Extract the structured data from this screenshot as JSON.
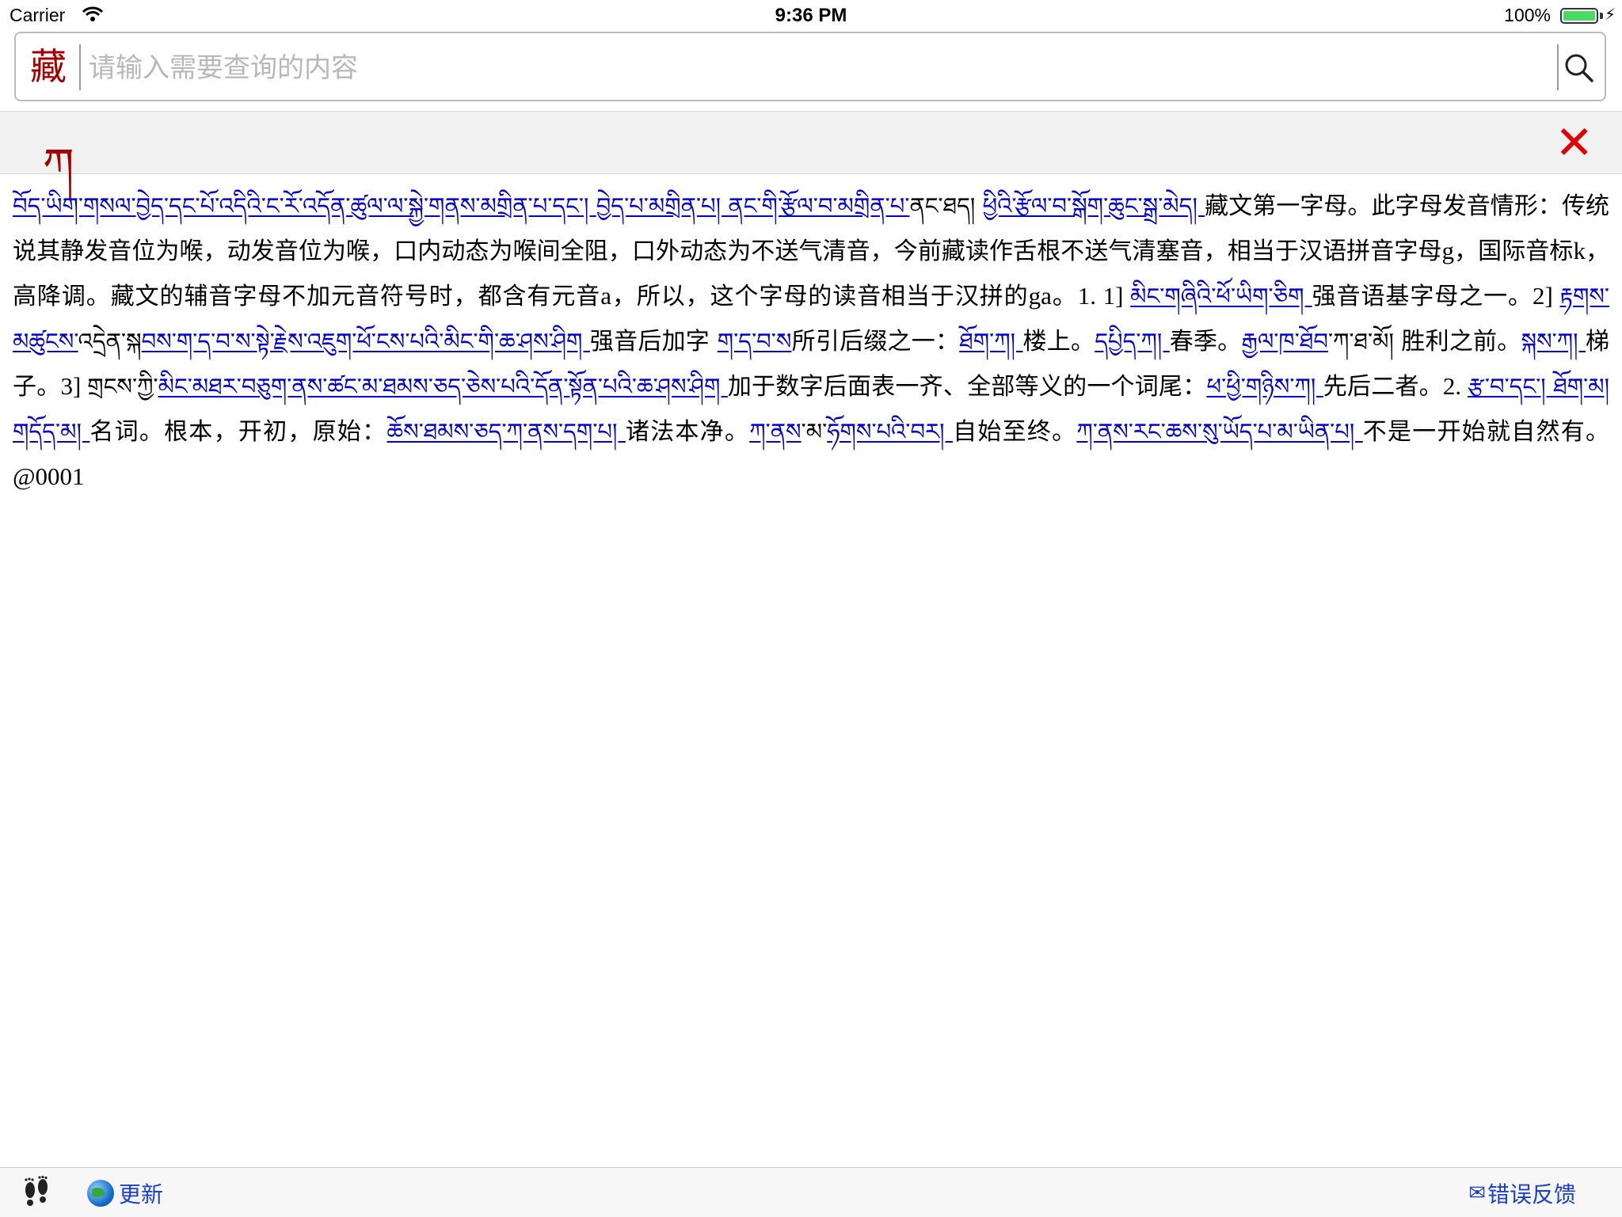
{
  "status_bar": {
    "carrier": "Carrier",
    "time": "9:36 PM",
    "battery": "100%",
    "battery_level": 1.0
  },
  "search": {
    "lang_toggle": "藏",
    "placeholder": "请输入需要查询的内容",
    "value": ""
  },
  "word": {
    "headword": "ཀ",
    "close_icon": "close-icon"
  },
  "definition": {
    "segments": [
      {
        "t": "བོད་ཡིག་གསལ་བྱེད་དང་པོ་འདིའི་ང་རོ་འདོན་ཚུལ་",
        "k": "tib"
      },
      {
        "t": "ལ་སྐྱེ་གནས་མགྲིན་པ་དང་། ",
        "k": "tib"
      },
      {
        "t": "བྱེད་པ་མགྲིན་པ། ",
        "k": "tib"
      },
      {
        "t": "ནང་གི་རྩོལ་བ་མགྲིན་པ་",
        "k": "tib"
      },
      {
        "t": "ནང་ཐད། ",
        "k": "tibplain"
      },
      {
        "t": "ཕྱིའི་རྩོལ་བ་སྒོག་ཆུང་སྒྲ་མེད། ",
        "k": "tib"
      },
      {
        "t": "藏文第一字母。此字母发音情形：传统说其静发音位为喉，动发音位为喉，口内动态为喉间全阻，口外动态为不送气清音，今前藏读作舌根不送气清塞音，相当于汉语拼音字母",
        "k": "zh"
      },
      {
        "t": "g",
        "k": "latin"
      },
      {
        "t": "，国际音标",
        "k": "zh"
      },
      {
        "t": "k",
        "k": "latin"
      },
      {
        "t": "，高降调。藏文的辅音字母不加元音符号时，都含有元音",
        "k": "zh"
      },
      {
        "t": "a",
        "k": "latin"
      },
      {
        "t": "，所以，这个字母的读音相当于汉拼的",
        "k": "zh"
      },
      {
        "t": "ga。1. 1] ",
        "k": "latin"
      },
      {
        "t": "མིང་གཞིའི་ཕོ་ཡིག་ཅིག ",
        "k": "tib"
      },
      {
        "t": "强音语基字母之一。",
        "k": "zh"
      },
      {
        "t": "2] ",
        "k": "latin"
      },
      {
        "t": "རྟགས་མཚུངས་",
        "k": "tib"
      },
      {
        "t": "འདྲེན་སྐ",
        "k": "tibplain"
      },
      {
        "t": "བས་ག་ད་བ་ས་སྟེ་རྗེས་འཇུག་ཕོ་ངས་པའི་མིང་གི་ཆ་ཤས་ཤིག ",
        "k": "tib"
      },
      {
        "t": "强音后加字 ",
        "k": "zh"
      },
      {
        "t": "ག་ད་བ་ས",
        "k": "tib"
      },
      {
        "t": "所引后缀之一：",
        "k": "zh"
      },
      {
        "t": "ཐོག་ཀ། ",
        "k": "tib"
      },
      {
        "t": "楼上。",
        "k": "zh"
      },
      {
        "t": "དཔྱིད་ཀ། ",
        "k": "tib"
      },
      {
        "t": "春季。",
        "k": "zh"
      },
      {
        "t": "རྒྱལ་ཁ་ཐོབ",
        "k": "tib"
      },
      {
        "t": "་ཀ་ཐ་མོ། ",
        "k": "tibplain"
      },
      {
        "t": "胜利之前。",
        "k": "zh"
      },
      {
        "t": "སྐས་ཀ། ",
        "k": "tib"
      },
      {
        "t": "梯子。",
        "k": "zh"
      },
      {
        "t": "3] ",
        "k": "latin"
      },
      {
        "t": "གྲངས་ཀྱི་",
        "k": "tibplain"
      },
      {
        "t": "མིང་མཐར་བཅུག་ནས་ཚང་མ་ཐམས་ཅད་ཅེས་པའི་དོན་སྟོན་པའི་ཆ་ཤས་ཤིག ",
        "k": "tib"
      },
      {
        "t": "加于数字后面表一齐、全部等义的一个词尾：",
        "k": "zh"
      },
      {
        "t": "ཕ་ཕྱི་གཉིས་ཀ། ",
        "k": "tib"
      },
      {
        "t": "先后二者。",
        "k": "zh"
      },
      {
        "t": "2. ",
        "k": "latin"
      },
      {
        "t": "རྩ་བ་དང་། ",
        "k": "tib"
      },
      {
        "t": "ཐོག་མ། ",
        "k": "tib"
      },
      {
        "t": "གདོད་མ། ",
        "k": "tib"
      },
      {
        "t": "名词。根本，开初，原始：",
        "k": "zh"
      },
      {
        "t": "ཆོས་ཐམས་ཅད་ཀ་ནས་དག་པ། ",
        "k": "tib"
      },
      {
        "t": "诸法本净。",
        "k": "zh"
      },
      {
        "t": "ཀ་ནས",
        "k": "tib"
      },
      {
        "t": "་མ་",
        "k": "tibplain"
      },
      {
        "t": "ཧོགས་པའི་བར། ",
        "k": "tib"
      },
      {
        "t": "自始至终。",
        "k": "zh"
      },
      {
        "t": "ཀ་ནས་རང་ཆས་སུ་ཡོད་པ་མ་ཡིན་པ། ",
        "k": "tib"
      },
      {
        "t": "不是一开始就自然有。",
        "k": "zh"
      },
      {
        "t": "@0001",
        "k": "latin"
      }
    ]
  },
  "toolbar": {
    "history_icon": "footprints-icon",
    "update_label": "更新",
    "feedback_label": "错误反馈",
    "mail_glyph": "✉"
  },
  "colors": {
    "accent_red": "#a40000",
    "link_blue": "#0000d0",
    "close_red": "#e00000"
  }
}
